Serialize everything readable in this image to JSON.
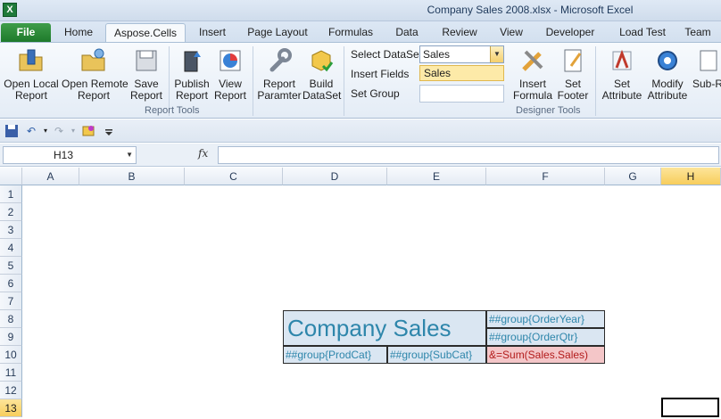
{
  "window": {
    "title": "Company Sales 2008.xlsx  -  Microsoft Excel",
    "app_icon": "X"
  },
  "tabs": [
    "File",
    "Home",
    "Aspose.Cells",
    "Insert",
    "Page Layout",
    "Formulas",
    "Data",
    "Review",
    "View",
    "Developer",
    "Load Test",
    "Team"
  ],
  "ribbon": {
    "report_tools": {
      "label": "Report Tools",
      "buttons": [
        [
          "Open Local",
          "Report"
        ],
        [
          "Open Remote",
          "Report"
        ],
        [
          "Save",
          "Report"
        ],
        [
          "Publish",
          "Report"
        ],
        [
          "View",
          "Report"
        ],
        [
          "Report",
          "Paramter"
        ],
        [
          "Build",
          "DataSet"
        ]
      ]
    },
    "designer_tools": {
      "label": "Designer Tools",
      "select_dataset_label": "Select DataSet",
      "select_dataset_value": "Sales",
      "dropdown_option": "Sales",
      "insert_fields_label": "Insert Fields",
      "set_group_label": "Set Group",
      "buttons": [
        [
          "Insert",
          "Formula"
        ],
        [
          "Set",
          "Footer"
        ],
        [
          "Set",
          "Attribute"
        ],
        [
          "Modify",
          "Attribute"
        ],
        [
          "Sub-R",
          ""
        ]
      ]
    }
  },
  "formula_bar": {
    "name_box": "H13",
    "fx": "fx",
    "formula": ""
  },
  "grid": {
    "columns": [
      "A",
      "B",
      "C",
      "D",
      "E",
      "F",
      "G",
      "H"
    ],
    "rows": [
      "1",
      "2",
      "3",
      "4",
      "5",
      "6",
      "7",
      "8",
      "9",
      "10",
      "11",
      "12",
      "13"
    ],
    "selected_column": "H",
    "selected_row": "13"
  },
  "cells": {
    "title": "Company Sales",
    "order_year": "##group{OrderYear}",
    "order_qtr": "##group{OrderQtr}",
    "prod_cat": "##group{ProdCat}",
    "sub_cat": "##group{SubCat}",
    "sum": "&=Sum(Sales.Sales)"
  },
  "colors": {
    "accent_green": "#1e7a2b",
    "selection_yellow": "#f7cd5c",
    "template_blue": "#2e86ab",
    "sum_bg": "#f4c6c8"
  }
}
